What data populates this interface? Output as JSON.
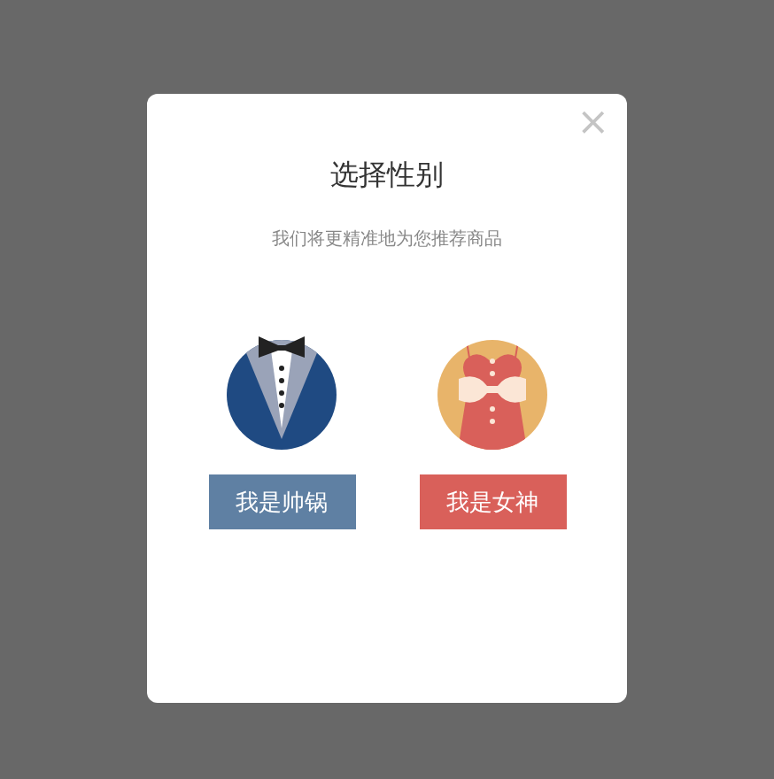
{
  "dialog": {
    "title": "选择性别",
    "subtitle": "我们将更精准地为您推荐商品",
    "close": "×",
    "options": [
      {
        "kind": "male",
        "label": "我是帅锅",
        "color": "#5f80a3"
      },
      {
        "kind": "female",
        "label": "我是女神",
        "color": "#d9605a"
      }
    ]
  }
}
